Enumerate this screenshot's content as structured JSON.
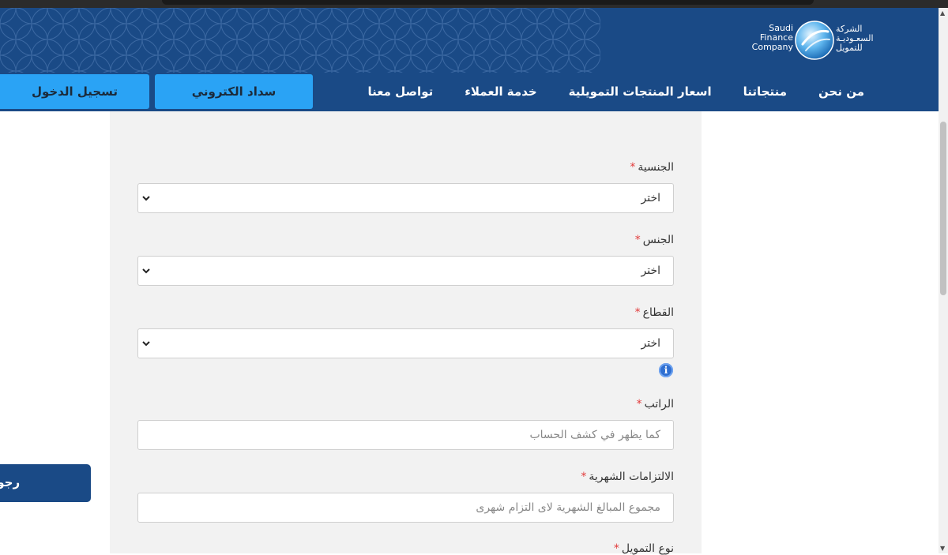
{
  "brand": {
    "name_en": [
      "Saudi",
      "Finance",
      "Company"
    ],
    "name_ar": [
      "الشركة",
      "السعـوديـة",
      "للتمويل"
    ],
    "color_primary": "#1a4a86",
    "color_accent": "#2aa3f5"
  },
  "nav": {
    "items": [
      "من نحن",
      "منتجاتنا",
      "اسعار المنتجات التمويلية",
      "خدمة العملاء",
      "تواصل معنا"
    ],
    "pay_button": "سداد الكتروني",
    "login_button": "تسجيل الدخول"
  },
  "form": {
    "nationality": {
      "label": "الجنسية",
      "value": "اختر"
    },
    "gender": {
      "label": "الجنس",
      "value": "اختر"
    },
    "sector": {
      "label": "القطاع",
      "value": "اختر"
    },
    "salary": {
      "label": "الراتب",
      "placeholder": "كما يظهر في كشف الحساب"
    },
    "obligations": {
      "label": "الالتزامات الشهرية",
      "placeholder": "مجموع المبالغ الشهرية لاى التزام شهرى"
    },
    "finance_type": {
      "label": "نوع التمويل"
    },
    "required_mark": "*",
    "info_glyph": "i"
  },
  "back_button": "رجوع"
}
